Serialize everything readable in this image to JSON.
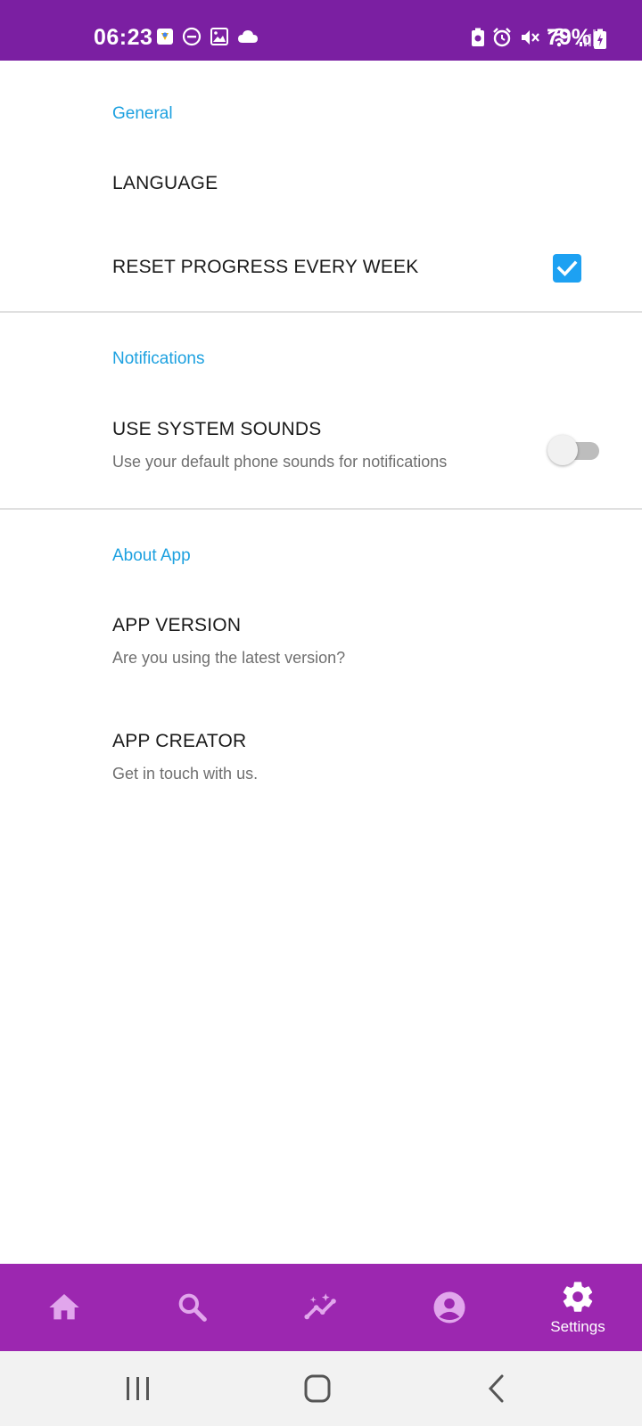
{
  "status_bar": {
    "time": "06:23",
    "battery_percent": "79%",
    "left_icons": [
      "gallery-app-icon",
      "dnd-icon",
      "image-icon",
      "cloud-icon"
    ],
    "right_icons": [
      "battery-saver-icon",
      "alarm-icon",
      "mute-icon",
      "wifi-icon",
      "signal-icon"
    ]
  },
  "sections": {
    "general": {
      "title": "General",
      "language": {
        "title": "LANGUAGE"
      },
      "reset_progress": {
        "title": "RESET PROGRESS EVERY WEEK",
        "checked": true
      }
    },
    "notifications": {
      "title": "Notifications",
      "system_sounds": {
        "title": "USE SYSTEM SOUNDS",
        "subtitle": "Use your default phone sounds for notifications",
        "enabled": false
      }
    },
    "about": {
      "title": "About App",
      "version": {
        "title": "APP VERSION",
        "subtitle": "Are you using the latest version?"
      },
      "creator": {
        "title": "APP CREATOR",
        "subtitle": "Get in touch with us."
      }
    }
  },
  "bottom_nav": {
    "items": [
      {
        "icon": "home-icon",
        "label": ""
      },
      {
        "icon": "search-icon",
        "label": ""
      },
      {
        "icon": "insights-icon",
        "label": ""
      },
      {
        "icon": "account-icon",
        "label": ""
      },
      {
        "icon": "settings-icon",
        "label": "Settings",
        "active": true
      }
    ]
  },
  "colors": {
    "status_bar": "#7b1fa2",
    "bottom_nav": "#9c27b0",
    "accent": "#1da1e0",
    "nav_inactive_icon": "#e1a6ec"
  }
}
